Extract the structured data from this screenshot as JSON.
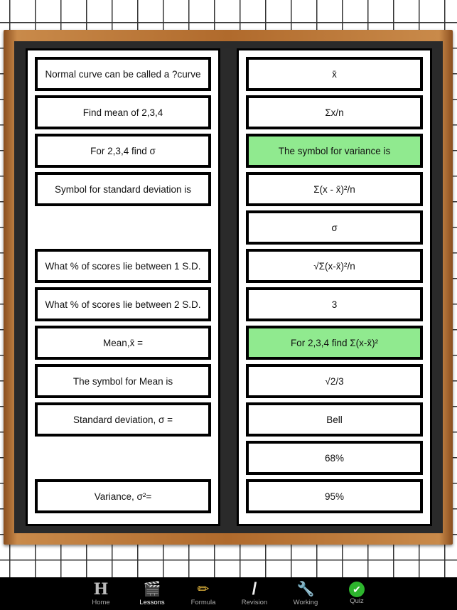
{
  "left_cards": [
    "Normal curve can be called a ?curve",
    "Find mean of 2,3,4",
    "For 2,3,4 find σ",
    "Symbol for standard deviation is",
    "",
    "What % of scores lie between 1 S.D.",
    "What % of scores lie between 2 S.D.",
    "Mean,x̄ =",
    "The symbol for Mean is",
    "Standard deviation, σ =",
    "",
    "Variance, σ²="
  ],
  "right_cards": [
    "x̄",
    "Σx/n",
    "The symbol for variance is",
    "Σ(x - x̄)²/n",
    "σ",
    "√Σ(x-x̄)²/n",
    "3",
    "For 2,3,4 find Σ(x-x̄)²",
    "√2/3",
    "Bell",
    "68%",
    "95%"
  ],
  "selected_right": [
    2,
    7
  ],
  "colors": {
    "selected": "#90ea8f",
    "board": "#2a2a2a",
    "frame": "#b06a2c"
  },
  "tabs": [
    {
      "label": "Home",
      "icon": "home-h-icon",
      "glyph": "H"
    },
    {
      "label": "Lessons",
      "icon": "clapperboard-icon",
      "glyph": "🎬",
      "active": true
    },
    {
      "label": "Formula",
      "icon": "pencil-icon",
      "glyph": "✏"
    },
    {
      "label": "Revision",
      "icon": "chalk-icon",
      "glyph": "/"
    },
    {
      "label": "Working",
      "icon": "wrench-icon",
      "glyph": "🔧"
    },
    {
      "label": "Quiz",
      "icon": "checkmark-icon",
      "glyph": "✔"
    }
  ]
}
